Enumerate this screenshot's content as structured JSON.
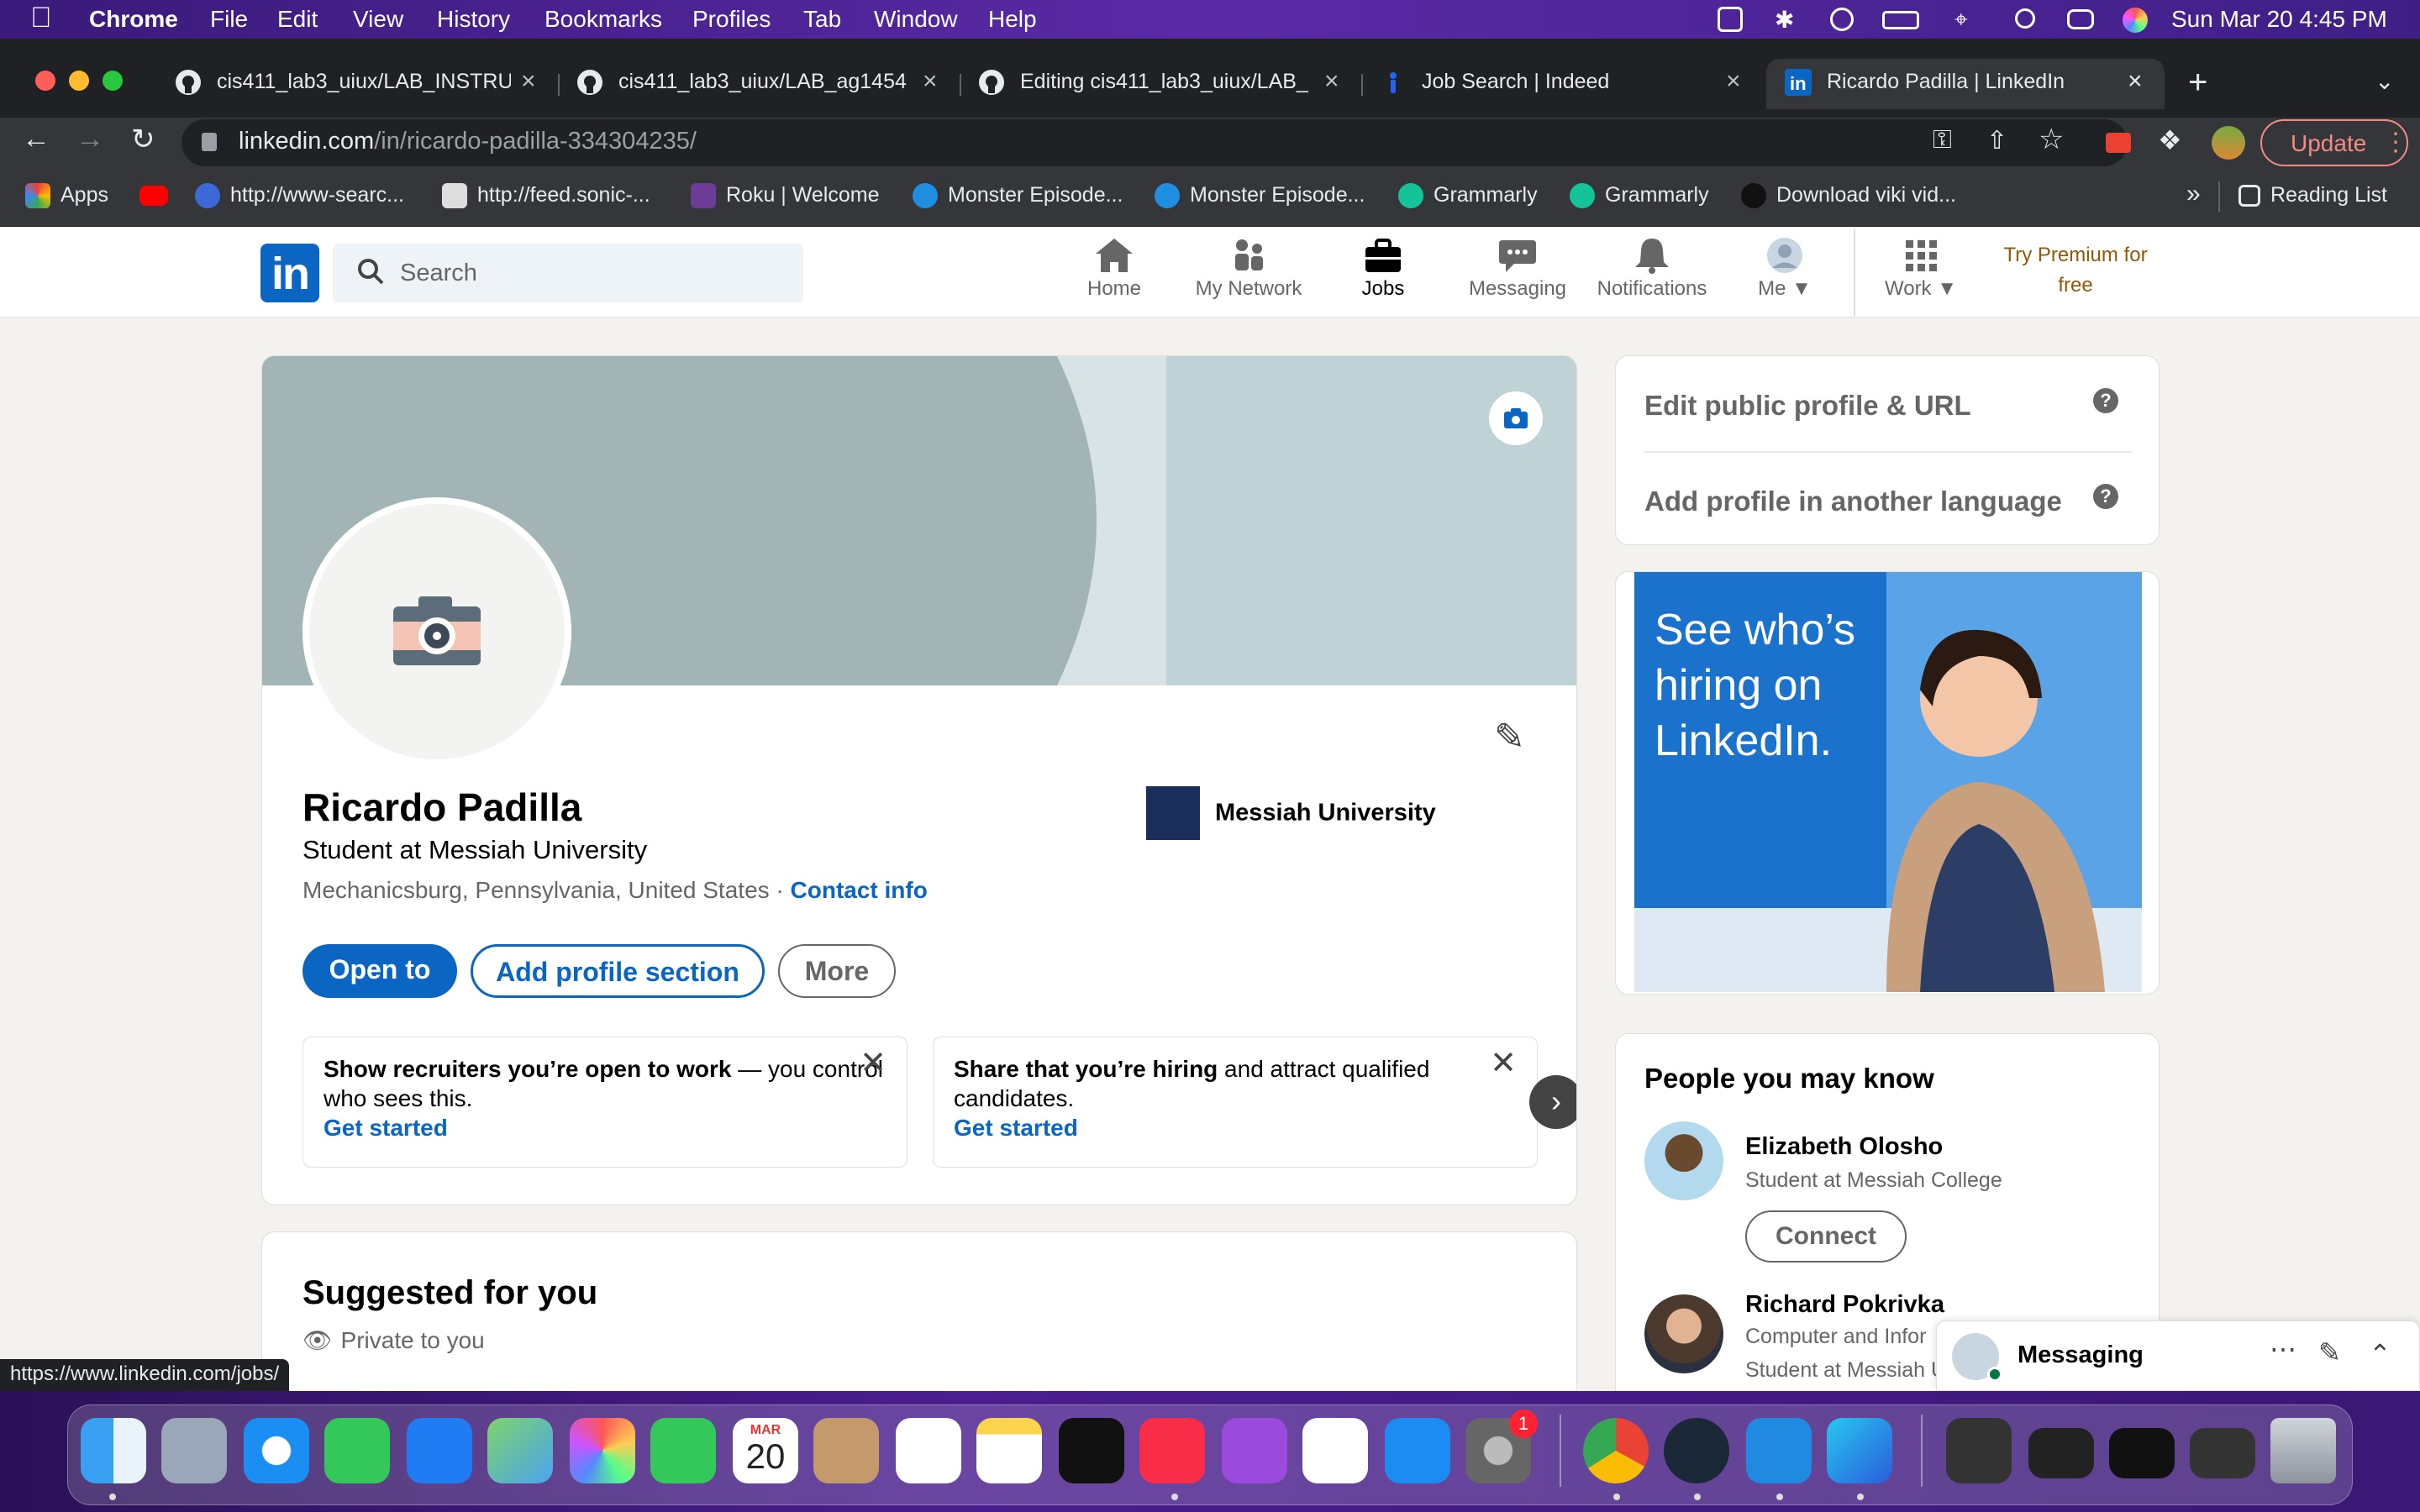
{
  "menubar": {
    "app": "Chrome",
    "items": [
      "File",
      "Edit",
      "View",
      "History",
      "Bookmarks",
      "Profiles",
      "Tab",
      "Window",
      "Help"
    ],
    "clock": "Sun Mar 20  4:45 PM"
  },
  "tabs": [
    {
      "title": "cis411_lab3_uiux/LAB_INSTRU"
    },
    {
      "title": "cis411_lab3_uiux/LAB_ag1454"
    },
    {
      "title": "Editing cis411_lab3_uiux/LAB_"
    },
    {
      "title": "Job Search | Indeed"
    },
    {
      "title": "Ricardo Padilla | LinkedIn"
    }
  ],
  "address": {
    "host": "linkedin.com",
    "path": "/in/ricardo-padilla-334304235/"
  },
  "update_label": "Update",
  "bookmarks": [
    {
      "label": "Apps"
    },
    {
      "label": "http://www-searc..."
    },
    {
      "label": "http://feed.sonic-..."
    },
    {
      "label": "Roku | Welcome"
    },
    {
      "label": "Monster Episode..."
    },
    {
      "label": "Monster Episode..."
    },
    {
      "label": "Grammarly"
    },
    {
      "label": "Grammarly"
    },
    {
      "label": "Download viki vid..."
    }
  ],
  "reading_list": "Reading List",
  "linkedin": {
    "logo": "in",
    "search_placeholder": "Search",
    "nav": [
      "Home",
      "My Network",
      "Jobs",
      "Messaging",
      "Notifications",
      "Me",
      "Work"
    ],
    "premium": "Try Premium for free"
  },
  "profile": {
    "name": "Ricardo Padilla",
    "headline": "Student at Messiah University",
    "location": "Mechanicsburg, Pennsylvania, United States",
    "separator": " · ",
    "contact": "Contact info",
    "school": "Messiah University",
    "buttons": {
      "open": "Open to",
      "add": "Add profile section",
      "more": "More"
    },
    "promos": [
      {
        "bold": "Show recruiters you’re open to work",
        "rest": " — you control who sees this.",
        "link": "Get started"
      },
      {
        "bold": "Share that you’re hiring",
        "rest": " and attract qualified candidates.",
        "link": "Get started"
      }
    ]
  },
  "suggested": {
    "title": "Suggested for you",
    "sub": "Private to you"
  },
  "sidebar": {
    "edit_url": "Edit public profile & URL",
    "add_lang": "Add profile in another language",
    "ad_text": "See who’s hiring on LinkedIn.",
    "pymk_title": "People you may know",
    "people": [
      {
        "name": "Elizabeth Olosho",
        "sub": "Student at Messiah College",
        "action": "Connect"
      },
      {
        "name": "Richard Pokrivka",
        "sub": "Computer and Infor",
        "sub2": "Student at Messiah U"
      }
    ]
  },
  "messaging": "Messaging",
  "status_url": "https://www.linkedin.com/jobs/",
  "dock_calendar": {
    "month": "MAR",
    "day": "20"
  },
  "dock_badge": "1",
  "colors": {
    "linkedin_blue": "#0a66c2",
    "premium": "#915907"
  }
}
